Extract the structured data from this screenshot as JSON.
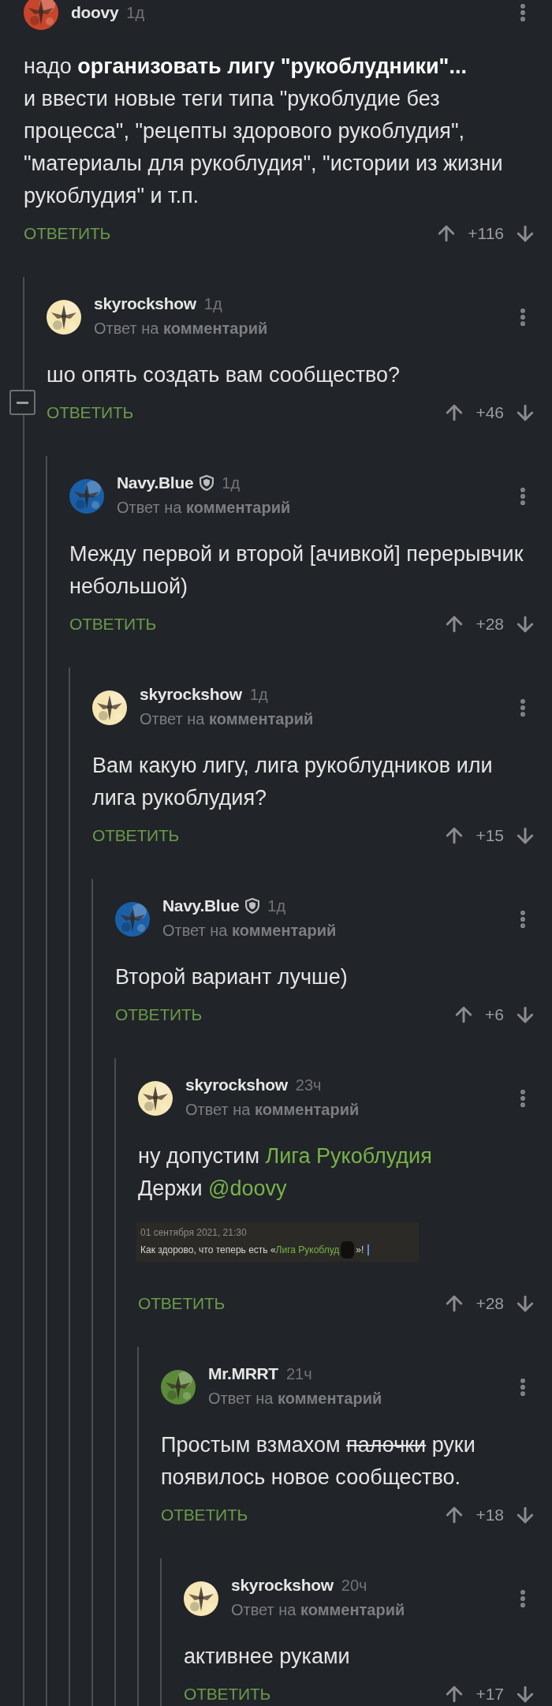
{
  "comments": [
    {
      "author": "doovy",
      "time": "1д",
      "avatar": {
        "kind": "picture",
        "color": "#c8452c"
      },
      "body": [
        [
          {
            "kind": "text",
            "text": "надо "
          },
          {
            "kind": "bold",
            "text": "организовать лигу \"рукоблудники\"..."
          }
        ],
        [
          {
            "kind": "text",
            "text": "и ввести новые теги типа \"рукоблудие без процесса\", \"рецепты здорового рукоблудия\", \"материалы для рукоблудия\", \"истории из жизни рукоблудия\" и т.п."
          }
        ]
      ],
      "reply_label": "ОТВЕТИТЬ",
      "score": "+116",
      "children": [
        {
          "author": "skyrockshow",
          "time": "1д",
          "avatar": {
            "kind": "picture",
            "color": "#f5e6b4"
          },
          "reply_to": "Ответ на **комментарий**",
          "collapse": {
            "expanded": true
          },
          "body": [
            [
              {
                "kind": "text",
                "text": "шо опять создать вам сообщество?"
              }
            ]
          ],
          "reply_label": "ОТВЕТИТЬ",
          "score": "+46",
          "children": [
            {
              "author": "Navy.Blue",
              "shield": true,
              "time": "1д",
              "avatar": {
                "kind": "picture",
                "color": "#1a5fa8"
              },
              "reply_to": "Ответ на **комментарий**",
              "body": [
                [
                  {
                    "kind": "text",
                    "text": "Между первой и второй [ачивкой] перерывчик небольшой)"
                  }
                ]
              ],
              "reply_label": "ОТВЕТИТЬ",
              "score": "+28",
              "children": [
                {
                  "author": "skyrockshow",
                  "time": "1д",
                  "avatar": {
                    "kind": "picture",
                    "color": "#f5e6b4"
                  },
                  "reply_to": "Ответ на **комментарий**",
                  "body": [
                    [
                      {
                        "kind": "text",
                        "text": "Вам какую лигу, лига рукоблудников или лига рукоблудия?"
                      }
                    ]
                  ],
                  "reply_label": "ОТВЕТИТЬ",
                  "score": "+15",
                  "children": [
                    {
                      "author": "Navy.Blue",
                      "shield": true,
                      "time": "1д",
                      "avatar": {
                        "kind": "picture",
                        "color": "#1a5fa8"
                      },
                      "reply_to": "Ответ на **комментарий**",
                      "body": [
                        [
                          {
                            "kind": "text",
                            "text": "Второй вариант лучше)"
                          }
                        ]
                      ],
                      "reply_label": "ОТВЕТИТЬ",
                      "score": "+6",
                      "children": [
                        {
                          "author": "skyrockshow",
                          "time": "23ч",
                          "avatar": {
                            "kind": "picture",
                            "color": "#f5e6b4"
                          },
                          "reply_to": "Ответ на **комментарий**",
                          "body": [
                            [
                              {
                                "kind": "text",
                                "text": "ну допустим "
                              },
                              {
                                "kind": "link",
                                "text": "Лига Рукоблудия"
                              }
                            ],
                            [
                              {
                                "kind": "text",
                                "text": "Держи "
                              },
                              {
                                "kind": "link",
                                "text": "@doovy"
                              }
                            ]
                          ],
                          "attachment": {
                            "kind": "screenshot",
                            "date": "01 сентября 2021, 21:30",
                            "text": [
                              {
                                "kind": "text",
                                "text": "Как здорово, что теперь есть «"
                              },
                              {
                                "kind": "link",
                                "text": "Лига Рукоблуд"
                              },
                              {
                                "kind": "cover"
                              },
                              {
                                "kind": "text",
                                "text": "»!"
                              },
                              {
                                "kind": "cursor"
                              }
                            ]
                          },
                          "reply_label": "ОТВЕТИТЬ",
                          "score": "+28",
                          "children": [
                            {
                              "author": "Mr.MRRT",
                              "time": "21ч",
                              "avatar": {
                                "kind": "picture",
                                "color": "#5c8a3a"
                              },
                              "reply_to": "Ответ на **комментарий**",
                              "body": [
                                [
                                  {
                                    "kind": "text",
                                    "text": "Простым взмахом "
                                  },
                                  {
                                    "kind": "strike",
                                    "text": "палочки"
                                  },
                                  {
                                    "kind": "text",
                                    "text": " руки появилось новое сообщество."
                                  }
                                ]
                              ],
                              "reply_label": "ОТВЕТИТЬ",
                              "score": "+18",
                              "children": [
                                {
                                  "author": "skyrockshow",
                                  "time": "20ч",
                                  "avatar": {
                                    "kind": "picture",
                                    "color": "#f5e6b4"
                                  },
                                  "reply_to": "Ответ на **комментарий**",
                                  "body": [
                                    [
                                      {
                                        "kind": "text",
                                        "text": "активнее руками"
                                      }
                                    ]
                                  ],
                                  "reply_label": "ОТВЕТИТЬ",
                                  "score": "+17"
                                }
                              ]
                            }
                          ]
                        }
                      ]
                    }
                  ]
                }
              ]
            }
          ]
        }
      ]
    }
  ]
}
